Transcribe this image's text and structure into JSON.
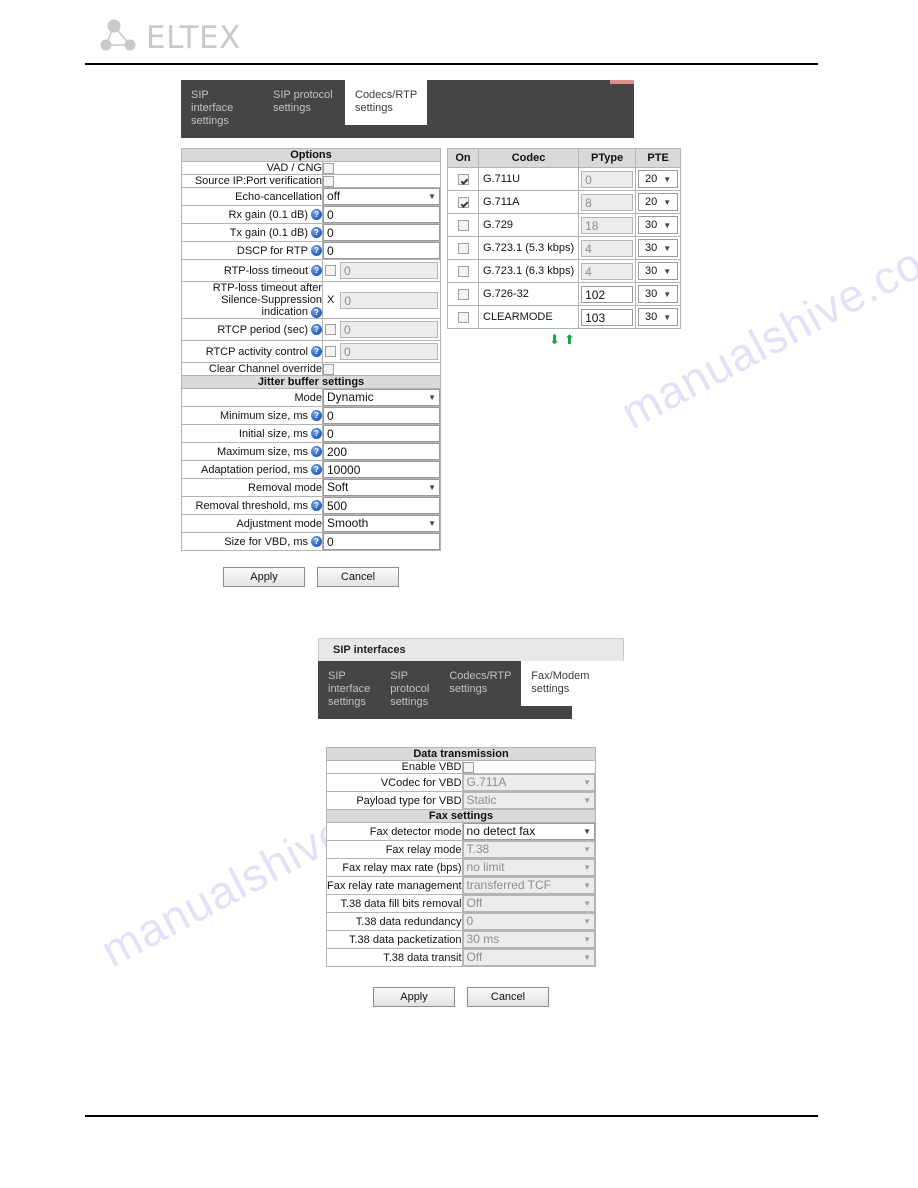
{
  "brand": {
    "name": "ELTEX",
    "logo_icon": "eltex-molecule-logo"
  },
  "watermark": {
    "text": "manualshive.com"
  },
  "panel1": {
    "tabs": [
      {
        "label": "SIP interface settings",
        "active": false
      },
      {
        "label": "SIP protocol settings",
        "active": false
      },
      {
        "label": "Codecs/RTP settings",
        "active": true
      }
    ],
    "options_header": "Options",
    "rows": [
      {
        "label": "VAD / CNG",
        "type": "checkbox",
        "checked": false,
        "help": false
      },
      {
        "label": "Source IP:Port verification",
        "type": "checkbox",
        "checked": false,
        "help": false
      },
      {
        "label": "Echo-cancellation",
        "type": "select",
        "value": "off",
        "disabled": false,
        "help": false
      },
      {
        "label": "Rx gain (0.1 dB)",
        "type": "text",
        "value": "0",
        "disabled": false,
        "help": true
      },
      {
        "label": "Tx gain (0.1 dB)",
        "type": "text",
        "value": "0",
        "disabled": false,
        "help": true
      },
      {
        "label": "DSCP for RTP",
        "type": "text",
        "value": "0",
        "disabled": false,
        "help": true
      },
      {
        "label": "RTP-loss timeout",
        "type": "check-text",
        "checked": false,
        "value": "0",
        "disabled": true,
        "help": true
      },
      {
        "label": "RTP-loss timeout after Silence-Suppression indication",
        "type": "x-text",
        "prefix": "X",
        "value": "0",
        "disabled": true,
        "help": true
      },
      {
        "label": "RTCP period (sec)",
        "type": "check-text",
        "checked": false,
        "value": "0",
        "disabled": true,
        "help": true
      },
      {
        "label": "RTCP activity control",
        "type": "check-text",
        "checked": false,
        "value": "0",
        "disabled": true,
        "help": true
      },
      {
        "label": "Clear Channel override",
        "type": "checkbox",
        "checked": false,
        "help": false
      }
    ],
    "jitter_header": "Jitter buffer settings",
    "jitter_rows": [
      {
        "label": "Mode",
        "type": "select",
        "value": "Dynamic",
        "disabled": false,
        "help": false
      },
      {
        "label": "Minimum size, ms",
        "type": "text",
        "value": "0",
        "disabled": false,
        "help": true
      },
      {
        "label": "Initial size, ms",
        "type": "text",
        "value": "0",
        "disabled": false,
        "help": true
      },
      {
        "label": "Maximum size, ms",
        "type": "text",
        "value": "200",
        "disabled": false,
        "help": true
      },
      {
        "label": "Adaptation period, ms",
        "type": "text",
        "value": "10000",
        "disabled": false,
        "help": true
      },
      {
        "label": "Removal mode",
        "type": "select",
        "value": "Soft",
        "disabled": false,
        "help": false
      },
      {
        "label": "Removal threshold, ms",
        "type": "text",
        "value": "500",
        "disabled": false,
        "help": true
      },
      {
        "label": "Adjustment mode",
        "type": "select",
        "value": "Smooth",
        "disabled": false,
        "help": false
      },
      {
        "label": "Size for VBD, ms",
        "type": "text",
        "value": "0",
        "disabled": false,
        "help": true
      }
    ],
    "codec_table": {
      "headers": [
        "On",
        "Codec",
        "PType",
        "PTE"
      ],
      "rows": [
        {
          "on": true,
          "codec": "G.711U",
          "ptype": "0",
          "ptype_disabled": true,
          "pte": "20"
        },
        {
          "on": true,
          "codec": "G.711A",
          "ptype": "8",
          "ptype_disabled": true,
          "pte": "20"
        },
        {
          "on": false,
          "codec": "G.729",
          "ptype": "18",
          "ptype_disabled": true,
          "pte": "30"
        },
        {
          "on": false,
          "codec": "G.723.1 (5.3 kbps)",
          "ptype": "4",
          "ptype_disabled": true,
          "pte": "30"
        },
        {
          "on": false,
          "codec": "G.723.1 (6.3 kbps)",
          "ptype": "4",
          "ptype_disabled": true,
          "pte": "30"
        },
        {
          "on": false,
          "codec": "G.726-32",
          "ptype": "102",
          "ptype_disabled": false,
          "pte": "30"
        },
        {
          "on": false,
          "codec": "CLEARMODE",
          "ptype": "103",
          "ptype_disabled": false,
          "pte": "30"
        }
      ],
      "move_down_icon": "arrow-down-icon",
      "move_up_icon": "arrow-up-icon"
    },
    "apply_label": "Apply",
    "cancel_label": "Cancel"
  },
  "panel2": {
    "title": "SIP interfaces",
    "tabs": [
      {
        "label": "SIP interface settings",
        "active": false
      },
      {
        "label": "SIP protocol settings",
        "active": false
      },
      {
        "label": "Codecs/RTP settings",
        "active": false
      },
      {
        "label": "Fax/Modem settings",
        "active": true
      }
    ],
    "data_header": "Data transmission",
    "data_rows": [
      {
        "label": "Enable VBD",
        "type": "checkbox",
        "checked": false
      },
      {
        "label": "VCodec for VBD",
        "type": "select",
        "value": "G.711A",
        "disabled": true
      },
      {
        "label": "Payload type for VBD",
        "type": "select",
        "value": "Static",
        "disabled": true
      }
    ],
    "fax_header": "Fax settings",
    "fax_rows": [
      {
        "label": "Fax detector mode",
        "type": "select",
        "value": "no detect fax",
        "disabled": false
      },
      {
        "label": "Fax relay mode",
        "type": "select",
        "value": "T.38",
        "disabled": true
      },
      {
        "label": "Fax relay max rate (bps)",
        "type": "select",
        "value": "no limit",
        "disabled": true
      },
      {
        "label": "Fax relay rate management",
        "type": "select",
        "value": "transferred TCF",
        "disabled": true
      },
      {
        "label": "T.38 data fill bits removal",
        "type": "select",
        "value": "Off",
        "disabled": true
      },
      {
        "label": "T.38 data redundancy",
        "type": "select",
        "value": "0",
        "disabled": true
      },
      {
        "label": "T.38 data packetization",
        "type": "select",
        "value": "30 ms",
        "disabled": true
      },
      {
        "label": "T.38 data transit",
        "type": "select",
        "value": "Off",
        "disabled": true
      }
    ],
    "apply_label": "Apply",
    "cancel_label": "Cancel"
  }
}
